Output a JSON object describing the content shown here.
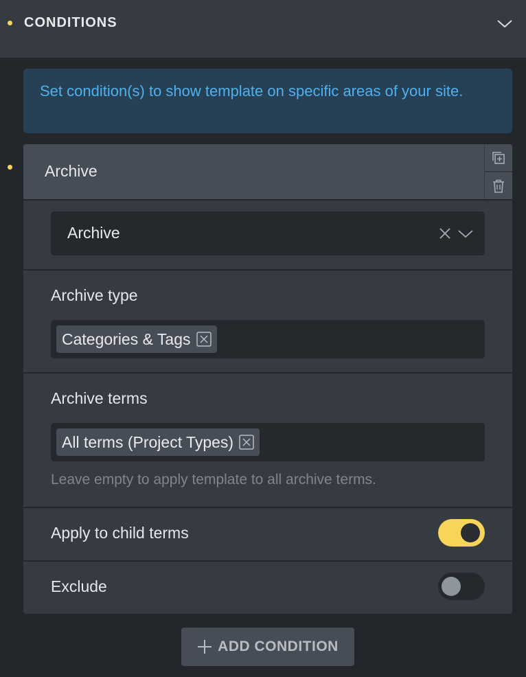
{
  "panel": {
    "title": "CONDITIONS",
    "info_text": "Set condition(s) to show template on specific areas of your site."
  },
  "condition": {
    "header_title": "Archive",
    "select_value": "Archive",
    "archive_type_label": "Archive type",
    "archive_type_tags": [
      "Categories & Tags"
    ],
    "archive_terms_label": "Archive terms",
    "archive_terms_tags": [
      "All terms (Project Types)"
    ],
    "archive_terms_hint": "Leave empty to apply template to all archive terms.",
    "apply_child_label": "Apply to child terms",
    "apply_child_on": true,
    "exclude_label": "Exclude",
    "exclude_on": false
  },
  "add_button_label": "ADD CONDITION",
  "colors": {
    "accent_dot": "#f6d55a",
    "toggle_on": "#f6d55a",
    "info_text": "#4fb0ee",
    "info_bg": "#264155"
  },
  "icons": [
    "chevron-down-icon",
    "duplicate-icon",
    "trash-icon",
    "clear-icon",
    "remove-tag-icon",
    "plus-icon"
  ]
}
